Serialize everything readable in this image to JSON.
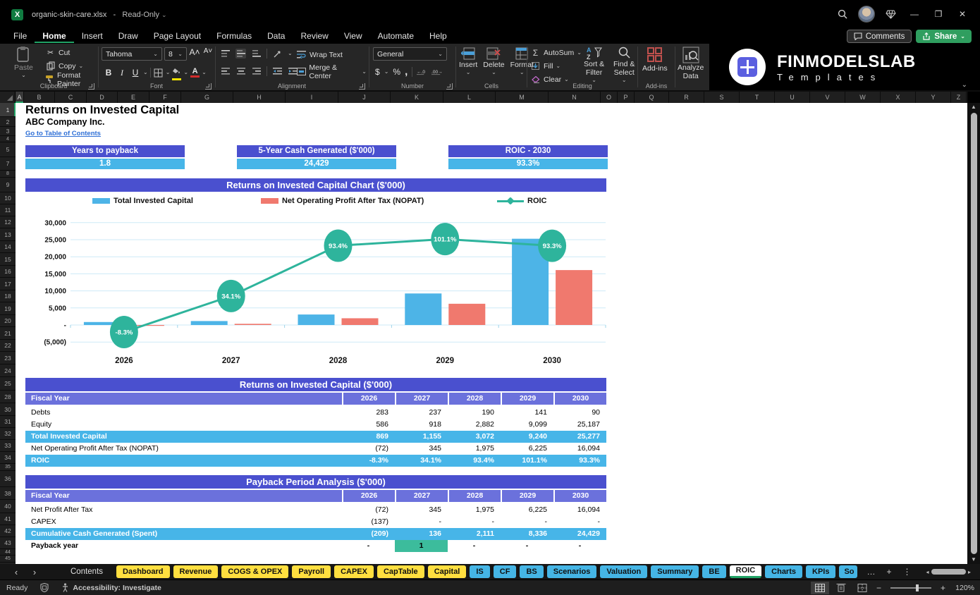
{
  "window": {
    "title": "organic-skin-care.xlsx",
    "sep": "-",
    "mode": "Read-Only"
  },
  "glyphs": {
    "chevron": "⌄",
    "scissors": "✂",
    "sigma": "Σ",
    "ellipsis": "…",
    "plus": "+",
    "kebab": "⋮",
    "nav_left": "‹",
    "nav_right": "›",
    "minimize": "—",
    "restore": "❐",
    "close": "✕",
    "dollar": "$",
    "percent": "%",
    "comma": ",",
    "bold": "B",
    "italic": "I",
    "underline": "U",
    "up": "▲",
    "down": "▼",
    "left": "◂",
    "right": "▸",
    "excel": "X",
    "font_a": "A"
  },
  "menu": {
    "items": [
      "File",
      "Home",
      "Insert",
      "Draw",
      "Page Layout",
      "Formulas",
      "Data",
      "Review",
      "View",
      "Automate",
      "Help"
    ],
    "active": "Home"
  },
  "top_actions": {
    "comments": "Comments",
    "share": "Share"
  },
  "ribbon": {
    "clipboard": {
      "label": "Clipboard",
      "paste": "Paste",
      "cut": "Cut",
      "copy": "Copy",
      "format_painter": "Format Painter"
    },
    "font": {
      "label": "Font",
      "family": "Tahoma",
      "size": "8"
    },
    "alignment": {
      "label": "Alignment",
      "wrap": "Wrap Text",
      "merge": "Merge & Center"
    },
    "number": {
      "label": "Number",
      "format": "General"
    },
    "cells": {
      "label": "Cells",
      "insert": "Insert",
      "delete": "Delete",
      "format": "Format"
    },
    "editing": {
      "label": "Editing",
      "autosum": "AutoSum",
      "fill": "Fill",
      "clear": "Clear",
      "sort": "Sort & Filter",
      "find": "Find & Select"
    },
    "addins": {
      "label": "Add-ins",
      "addins": "Add-ins",
      "analyze": "Analyze Data"
    }
  },
  "brand": {
    "name": "FINMODELSLAB",
    "sub": "Templates"
  },
  "grid": {
    "columns": [
      "A",
      "B",
      "C",
      "D",
      "E",
      "F",
      "G",
      "H",
      "I",
      "J",
      "K",
      "L",
      "M",
      "N",
      "O",
      "P",
      "Q",
      "R",
      "S",
      "T",
      "U",
      "V",
      "W",
      "X",
      "Y",
      "Z"
    ],
    "rows": [
      "1",
      "2",
      "3",
      "4",
      "5",
      "7",
      "8",
      "9",
      "10",
      "11",
      "12",
      "13",
      "14",
      "15",
      "16",
      "17",
      "18",
      "19",
      "20",
      "21",
      "22",
      "23",
      "24",
      "25",
      "28",
      "30",
      "31",
      "32",
      "33",
      "34",
      "35",
      "36",
      "38",
      "40",
      "41",
      "42",
      "43",
      "44",
      "45"
    ]
  },
  "sheet": {
    "title": "Returns on Invested Capital",
    "company": "ABC Company Inc.",
    "link": "Go to Table of Contents",
    "kpis": [
      {
        "label": "Years to payback",
        "value": "1.8"
      },
      {
        "label": "5-Year Cash Generated ($'000)",
        "value": "24,429"
      },
      {
        "label": "ROIC - 2030",
        "value": "93.3%"
      }
    ]
  },
  "chart_data": {
    "type": "bar+line",
    "title": "Returns on Invested Capital Chart ($'000)",
    "categories": [
      "2026",
      "2027",
      "2028",
      "2029",
      "2030"
    ],
    "series": [
      {
        "name": "Total Invested Capital",
        "type": "bar",
        "color": "#4db4e7",
        "values": [
          869,
          1155,
          3072,
          9240,
          25277
        ]
      },
      {
        "name": "Net Operating Profit After Tax (NOPAT)",
        "type": "bar",
        "color": "#f0796e",
        "values": [
          -72,
          345,
          1975,
          6225,
          16094
        ]
      },
      {
        "name": "ROIC",
        "type": "line",
        "color": "#2eb49c",
        "unit": "%",
        "values": [
          -8.3,
          34.1,
          93.4,
          101.1,
          93.3
        ],
        "labels": [
          "-8.3%",
          "34.1%",
          "93.4%",
          "101.1%",
          "93.3%"
        ]
      }
    ],
    "y_axis": {
      "ticks": [
        {
          "value": 30000,
          "label": "30,000"
        },
        {
          "value": 25000,
          "label": "25,000"
        },
        {
          "value": 20000,
          "label": "20,000"
        },
        {
          "value": 15000,
          "label": "15,000"
        },
        {
          "value": 10000,
          "label": "10,000"
        },
        {
          "value": 5000,
          "label": "5,000"
        },
        {
          "value": 0,
          "label": "-"
        },
        {
          "value": -5000,
          "label": "(5,000)"
        }
      ],
      "ylim": [
        -5000,
        30000
      ]
    },
    "grid": true,
    "legend_position": "top"
  },
  "tables": [
    {
      "title": "Returns on Invested Capital ($'000)",
      "header": [
        "Fiscal Year",
        "2026",
        "2027",
        "2028",
        "2029",
        "2030"
      ],
      "rows": [
        {
          "label": "Debts",
          "values": [
            "283",
            "237",
            "190",
            "141",
            "90"
          ],
          "style": "plain"
        },
        {
          "label": "Equity",
          "values": [
            "586",
            "918",
            "2,882",
            "9,099",
            "25,187"
          ],
          "style": "plain"
        },
        {
          "label": "Total Invested Capital",
          "values": [
            "869",
            "1,155",
            "3,072",
            "9,240",
            "25,277"
          ],
          "style": "total"
        },
        {
          "label": "Net Operating Profit After Tax (NOPAT)",
          "values": [
            "(72)",
            "345",
            "1,975",
            "6,225",
            "16,094"
          ],
          "style": "plain"
        },
        {
          "label": "ROIC",
          "values": [
            "-8.3%",
            "34.1%",
            "93.4%",
            "101.1%",
            "93.3%"
          ],
          "style": "total"
        }
      ]
    },
    {
      "title": "Payback Period Analysis ($'000)",
      "header": [
        "Fiscal Year",
        "2026",
        "2027",
        "2028",
        "2029",
        "2030"
      ],
      "rows": [
        {
          "label": "Net Profit After Tax",
          "values": [
            "(72)",
            "345",
            "1,975",
            "6,225",
            "16,094"
          ],
          "style": "plain"
        },
        {
          "label": "CAPEX",
          "values": [
            "(137)",
            "-",
            "-",
            "-",
            "-"
          ],
          "style": "plain"
        },
        {
          "label": "Cumulative Cash Generated (Spent)",
          "values": [
            "(209)",
            "136",
            "2,111",
            "8,336",
            "24,429"
          ],
          "style": "total"
        },
        {
          "label": "Payback year",
          "values": [
            "-",
            "1",
            "-",
            "-",
            "-"
          ],
          "style": "boldrow",
          "highlight_col": 1
        }
      ]
    }
  ],
  "sheet_tabs": {
    "tabs": [
      {
        "label": "Contents",
        "color": "plain"
      },
      {
        "label": "Dashboard",
        "color": "yellow"
      },
      {
        "label": "Revenue",
        "color": "yellow"
      },
      {
        "label": "COGS & OPEX",
        "color": "yellow"
      },
      {
        "label": "Payroll",
        "color": "yellow"
      },
      {
        "label": "CAPEX",
        "color": "yellow"
      },
      {
        "label": "CapTable",
        "color": "yellow"
      },
      {
        "label": "Capital",
        "color": "yellow"
      },
      {
        "label": "IS",
        "color": "blue"
      },
      {
        "label": "CF",
        "color": "blue"
      },
      {
        "label": "BS",
        "color": "blue"
      },
      {
        "label": "Scenarios",
        "color": "blue"
      },
      {
        "label": "Valuation",
        "color": "blue"
      },
      {
        "label": "Summary",
        "color": "blue"
      },
      {
        "label": "BE",
        "color": "blue"
      },
      {
        "label": "ROIC",
        "color": "active"
      },
      {
        "label": "Charts",
        "color": "blue"
      },
      {
        "label": "KPIs",
        "color": "blue"
      },
      {
        "label": "So",
        "color": "blue",
        "clipped": true
      }
    ]
  },
  "statusbar": {
    "ready": "Ready",
    "accessibility": "Accessibility: Investigate",
    "zoom": "120%"
  }
}
